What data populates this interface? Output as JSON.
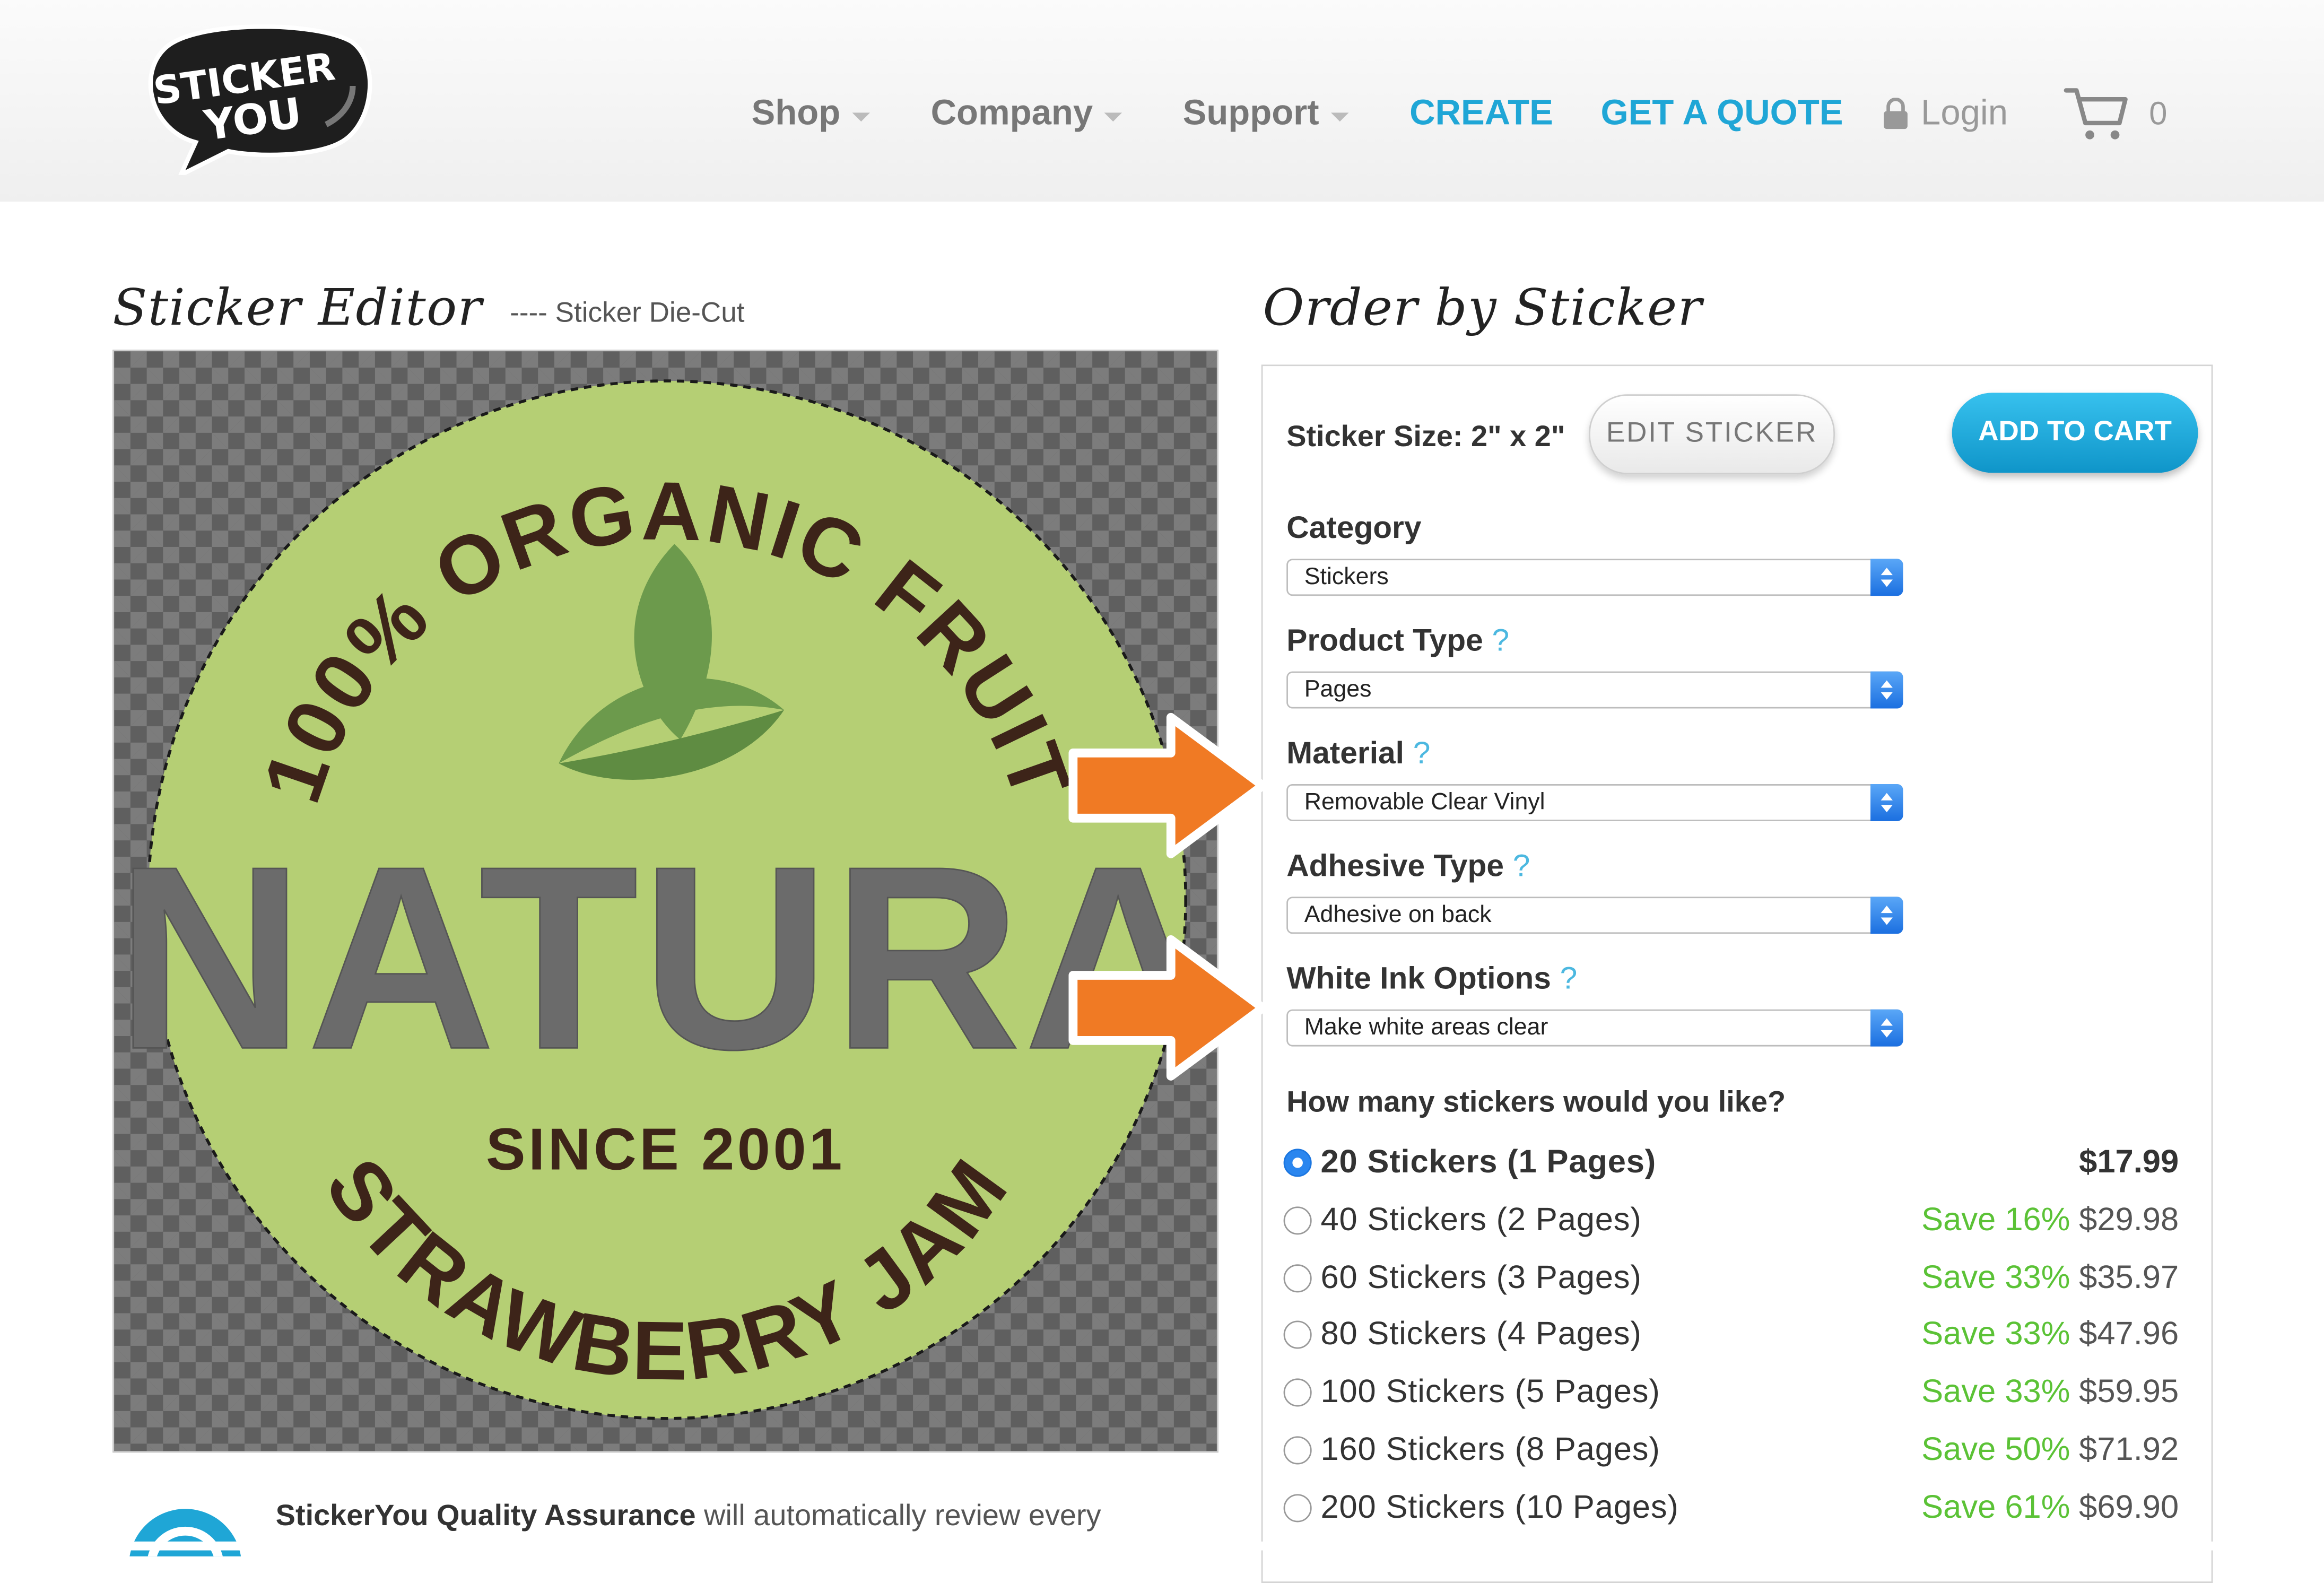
{
  "header": {
    "logo_line1": "STICKER",
    "logo_line2": "YOU",
    "nav": {
      "shop": "Shop",
      "company": "Company",
      "support": "Support",
      "create": "CREATE",
      "quote": "GET A QUOTE",
      "login": "Login",
      "cart_count": "0"
    }
  },
  "editor": {
    "title": "Sticker Editor",
    "die_cut_label": "---- Sticker Die-Cut",
    "sticker": {
      "arc_top": "100% ORGANIC FRUIT",
      "brand": "NATURA",
      "since": "SINCE 2001",
      "arc_bottom": "STRAWBERRY JAM",
      "colors": {
        "circle": "#b5cf74",
        "text": "#3d2419",
        "leaf": "#6c9a4c"
      }
    },
    "quality_strong": "StickerYou Quality Assurance",
    "quality_rest": " will automatically review every"
  },
  "order": {
    "title": "Order by Sticker",
    "size_label": "Sticker Size: 2\" x 2\"",
    "edit_button": "EDIT STICKER",
    "add_to_cart": "ADD TO CART",
    "fields": {
      "category": {
        "label": "Category",
        "value": "Stickers"
      },
      "product_type": {
        "label": "Product Type",
        "help": "?",
        "value": "Pages"
      },
      "material": {
        "label": "Material",
        "help": "?",
        "value": "Removable Clear Vinyl"
      },
      "adhesive": {
        "label": "Adhesive Type",
        "help": "?",
        "value": "Adhesive on back"
      },
      "white_ink": {
        "label": "White Ink Options",
        "help": "?",
        "value": "Make white areas clear"
      }
    },
    "quantity_question": "How many stickers would you like?",
    "quantities": [
      {
        "label": "20 Stickers (1 Pages)",
        "save": "",
        "price": "$17.99",
        "selected": true
      },
      {
        "label": "40 Stickers (2 Pages)",
        "save": "Save 16%",
        "price": "$29.98",
        "selected": false
      },
      {
        "label": "60 Stickers (3 Pages)",
        "save": "Save 33%",
        "price": "$35.97",
        "selected": false
      },
      {
        "label": "80 Stickers (4 Pages)",
        "save": "Save 33%",
        "price": "$47.96",
        "selected": false
      },
      {
        "label": "100 Stickers (5 Pages)",
        "save": "Save 33%",
        "price": "$59.95",
        "selected": false
      },
      {
        "label": "160 Stickers (8 Pages)",
        "save": "Save 50%",
        "price": "$71.92",
        "selected": false
      },
      {
        "label": "200 Stickers (10 Pages)",
        "save": "Save 61%",
        "price": "$69.90",
        "selected": false
      }
    ]
  },
  "colors": {
    "accent": "#1fa6d6",
    "save_green": "#5bc236",
    "arrow_orange": "#f07a24"
  }
}
